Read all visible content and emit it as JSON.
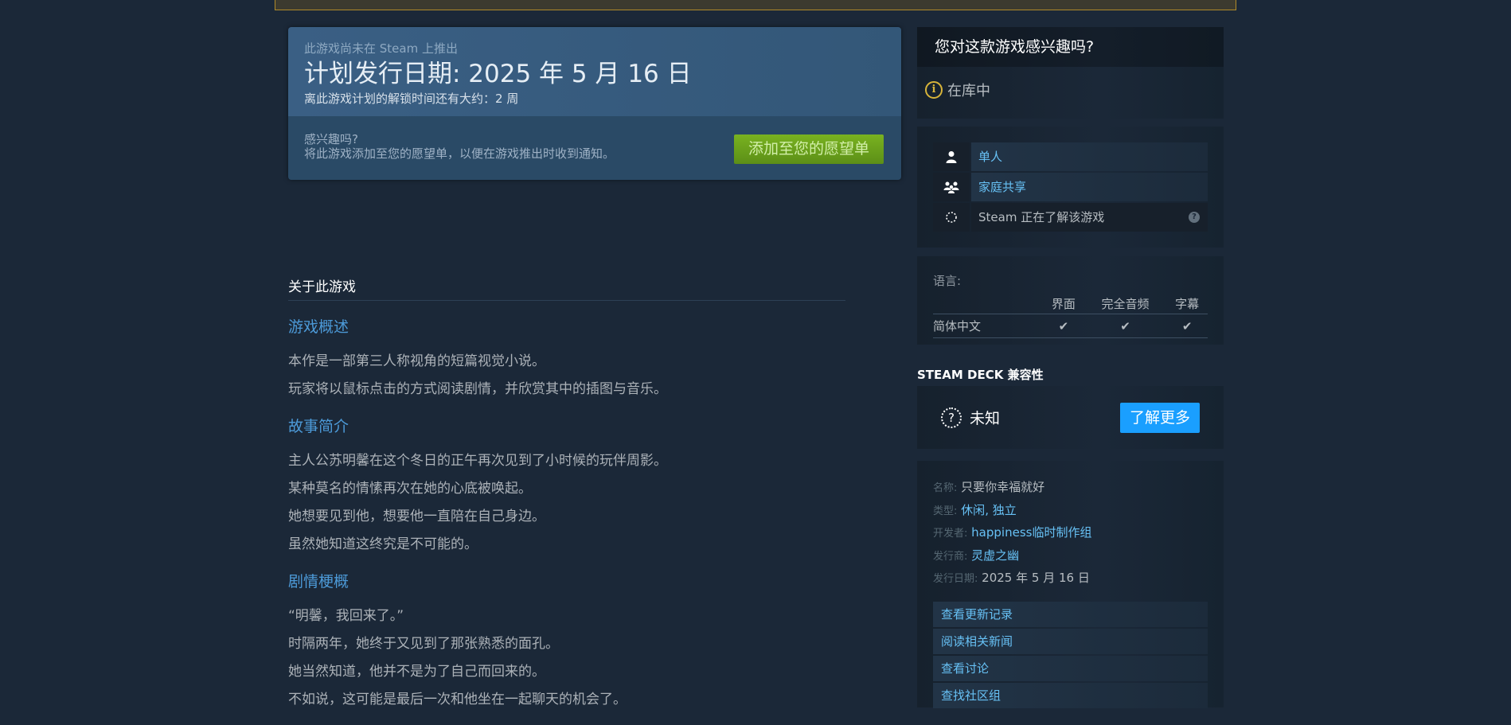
{
  "release": {
    "subtitle": "此游戏尚未在 Steam 上推出",
    "title": "计划发行日期: 2025 年 5 月 16 日",
    "remaining": "离此游戏计划的解锁时间还有大约：2 周",
    "question": "感兴趣吗?",
    "description": "将此游戏添加至您的愿望单，以便在游戏推出时收到通知。",
    "wishlist_button": "添加至您的愿望单"
  },
  "about": {
    "heading": "关于此游戏",
    "sections": [
      {
        "title": "游戏概述",
        "lines": [
          "本作是一部第三人称视角的短篇视觉小说。",
          "玩家将以鼠标点击的方式阅读剧情，并欣赏其中的插图与音乐。"
        ]
      },
      {
        "title": "故事简介",
        "lines": [
          "主人公苏明馨在这个冬日的正午再次见到了小时候的玩伴周影。",
          "某种莫名的情愫再次在她的心底被唤起。",
          "她想要见到他，想要他一直陪在自己身边。",
          "虽然她知道这终究是不可能的。"
        ]
      },
      {
        "title": "剧情梗概",
        "lines": [
          "“明馨，我回来了。”",
          "时隔两年，她终于又见到了那张熟悉的面孔。",
          "她当然知道，他并不是为了自己而回来的。",
          "不如说，这可能是最后一次和他坐在一起聊天的机会了。"
        ]
      }
    ]
  },
  "interest": {
    "header": "您对这款游戏感兴趣吗?",
    "status": "在库中"
  },
  "features": [
    {
      "icon": "single-player-icon",
      "label": "单人"
    },
    {
      "icon": "family-sharing-icon",
      "label": "家庭共享"
    },
    {
      "icon": "loading-icon",
      "label": "Steam 正在了解该游戏"
    }
  ],
  "languages": {
    "label": "语言:",
    "columns": [
      "界面",
      "完全音频",
      "字幕"
    ],
    "rows": [
      {
        "name": "简体中文",
        "interface": "✔",
        "audio": "✔",
        "subtitles": "✔"
      }
    ]
  },
  "deck": {
    "title": "STEAM DECK 兼容性",
    "status": "未知",
    "learn_more": "了解更多"
  },
  "details": {
    "name_key": "名称:",
    "name_val": "只要你幸福就好",
    "genre_key": "类型:",
    "genre_1": "休闲",
    "genre_sep": ", ",
    "genre_2": "独立",
    "developer_key": "开发者:",
    "developer_val": "happiness临时制作组",
    "publisher_key": "发行商:",
    "publisher_val": "灵虚之幽",
    "release_key": "发行日期:",
    "release_val": "2025 年 5 月 16 日"
  },
  "links": [
    "查看更新记录",
    "阅读相关新闻",
    "查看讨论",
    "查找社区组"
  ],
  "colors": {
    "background": "#1b2838",
    "wishlist_green": "#79b220",
    "link_blue": "#67c1f5",
    "deck_button": "#1a9fff"
  }
}
